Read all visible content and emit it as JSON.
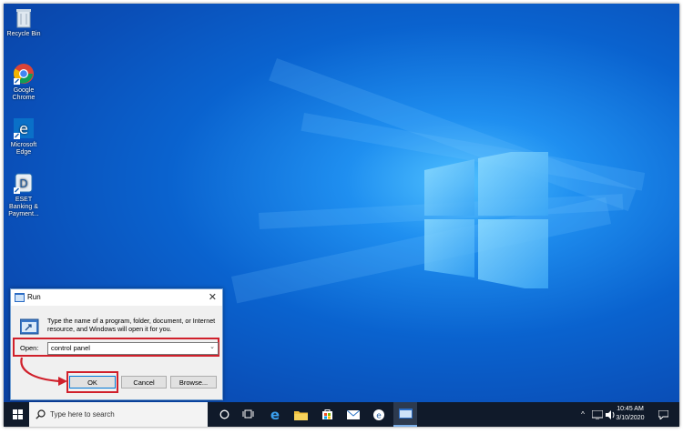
{
  "desktop": {
    "icons": [
      {
        "label": "Recycle Bin",
        "icon": "recycle-bin-icon"
      },
      {
        "label": "Google Chrome",
        "icon": "chrome-icon"
      },
      {
        "label": "Microsoft Edge",
        "icon": "edge-icon"
      },
      {
        "label": "ESET Banking & Payment...",
        "icon": "eset-icon"
      }
    ]
  },
  "run_dialog": {
    "title": "Run",
    "description": "Type the name of a program, folder, document, or Internet resource, and Windows will open it for you.",
    "open_label": "Open:",
    "open_value": "control panel",
    "ok_label": "OK",
    "cancel_label": "Cancel",
    "browse_label": "Browse...",
    "highlight_color": "#d0202b"
  },
  "taskbar": {
    "search_placeholder": "Type here to search",
    "time": "10:45 AM",
    "date": "3/10/2020",
    "apps": [
      "cortana-icon",
      "task-view-icon",
      "edge-icon",
      "file-explorer-icon",
      "store-icon",
      "mail-icon",
      "eset-icon",
      "run-icon"
    ]
  },
  "colors": {
    "desktop": "#0a63cf",
    "taskbar": "#101a2a",
    "accent": "#0078d7"
  }
}
